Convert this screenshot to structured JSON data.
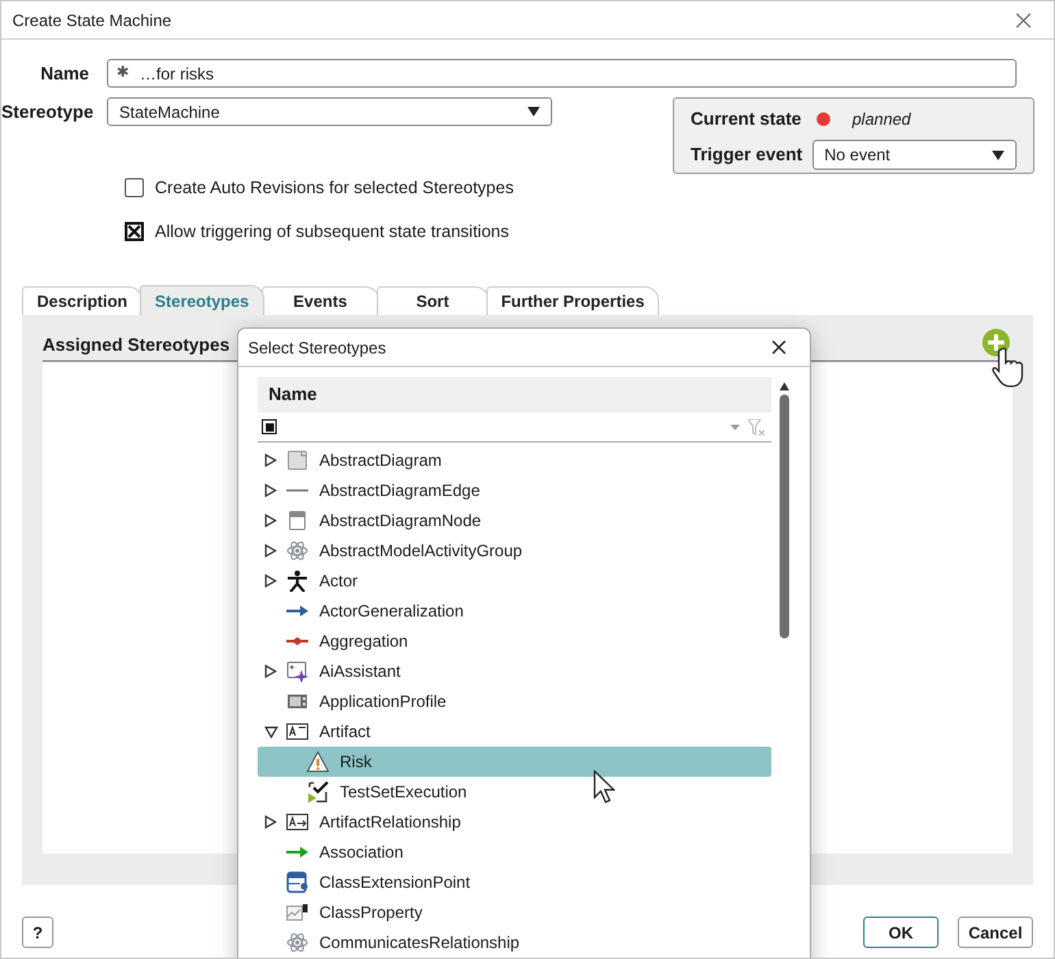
{
  "window": {
    "title": "Create State Machine"
  },
  "form": {
    "name_label": "Name",
    "name_prefix": "✱",
    "name_value": "…for risks",
    "stereotype_label": "Stereotype",
    "stereotype_value": "StateMachine"
  },
  "state_panel": {
    "current_state_label": "Current state",
    "color": "#e53935",
    "state": "planned",
    "trigger_label": "Trigger event",
    "trigger_value": "No event"
  },
  "options": [
    {
      "label": "Create Auto Revisions for selected Stereotypes",
      "checked": false
    },
    {
      "label": "Allow triggering of subsequent state transitions",
      "checked": true
    }
  ],
  "tabs": [
    {
      "label": "Description",
      "selected": false
    },
    {
      "label": "Stereotypes",
      "selected": true
    },
    {
      "label": "Events",
      "selected": false
    },
    {
      "label": "Sort",
      "selected": false
    },
    {
      "label": "Further Properties",
      "selected": false
    }
  ],
  "panel": {
    "title": "Assigned Stereotypes"
  },
  "popup": {
    "title": "Select Stereotypes",
    "column": "Name",
    "filter_indeterminate": true,
    "items": [
      {
        "label": "AbstractDiagram",
        "kind": "diagram",
        "expanded": false,
        "selected": false
      },
      {
        "label": "AbstractDiagramEdge",
        "kind": "edge",
        "expanded": false,
        "selected": false
      },
      {
        "label": "AbstractDiagramNode",
        "kind": "node",
        "expanded": false,
        "selected": false
      },
      {
        "label": "AbstractModelActivityGroup",
        "kind": "atom",
        "expanded": false,
        "selected": false
      },
      {
        "label": "Actor",
        "kind": "actor",
        "expanded": false,
        "selected": false
      },
      {
        "label": "ActorGeneralization",
        "kind": "blue-arrow",
        "selected": false
      },
      {
        "label": "Aggregation",
        "kind": "aggregation",
        "selected": false
      },
      {
        "label": "AiAssistant",
        "kind": "ai",
        "expanded": false,
        "selected": false
      },
      {
        "label": "ApplicationProfile",
        "kind": "profile",
        "selected": false
      },
      {
        "label": "Artifact",
        "kind": "artifact",
        "expanded": true,
        "selected": false,
        "children": [
          {
            "label": "Risk",
            "kind": "risk",
            "selected": true
          },
          {
            "label": "TestSetExecution",
            "kind": "test",
            "selected": false
          }
        ]
      },
      {
        "label": "ArtifactRelationship",
        "kind": "artifact-rel",
        "expanded": false,
        "selected": false
      },
      {
        "label": "Association",
        "kind": "green-arrow",
        "selected": false
      },
      {
        "label": "ClassExtensionPoint",
        "kind": "class-ext",
        "selected": false
      },
      {
        "label": "ClassProperty",
        "kind": "class-prop",
        "selected": false
      },
      {
        "label": "CommunicatesRelationship",
        "kind": "atom",
        "selected": false
      }
    ]
  },
  "buttons": {
    "help": "?",
    "ok": "OK",
    "cancel": "Cancel"
  }
}
